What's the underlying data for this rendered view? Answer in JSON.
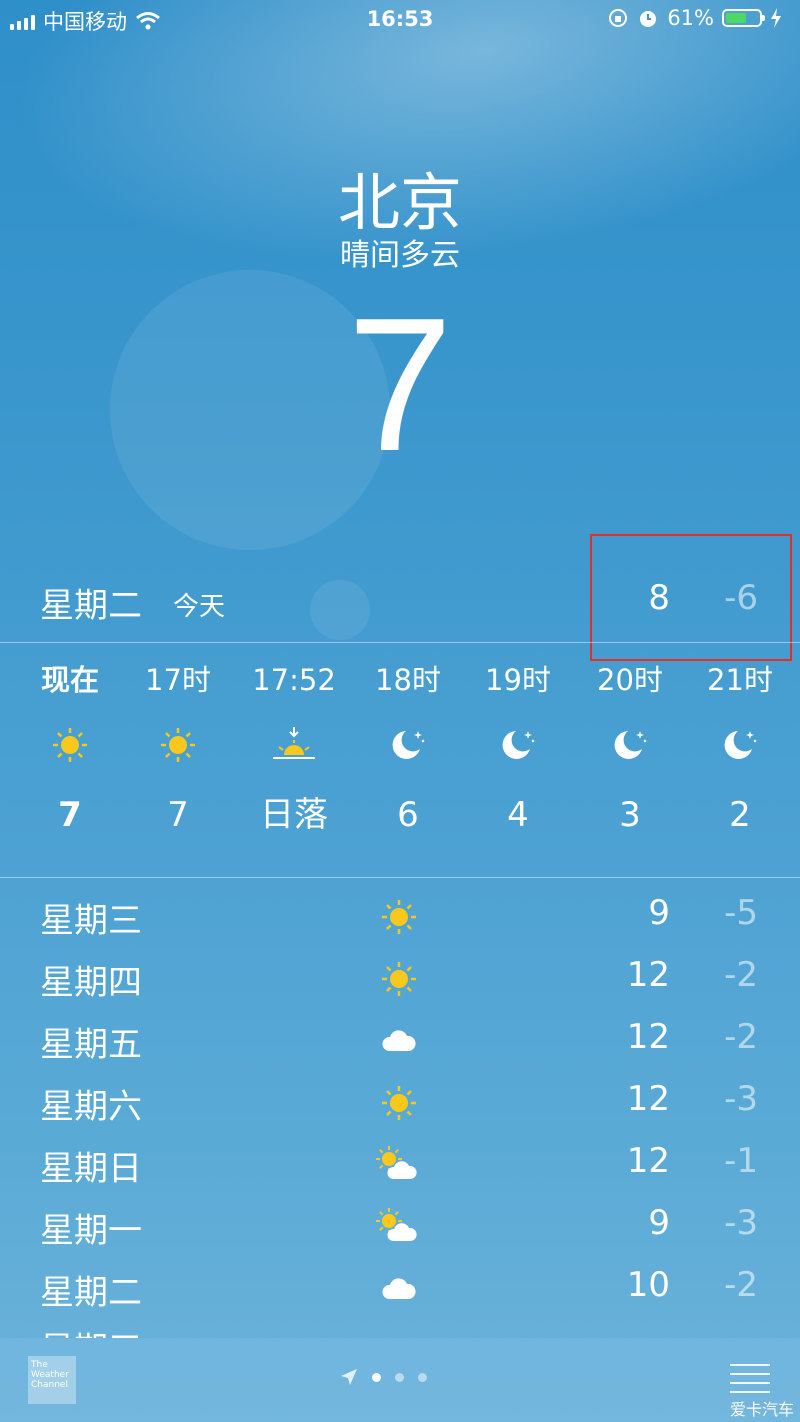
{
  "status_bar": {
    "carrier": "中国移动",
    "time": "16:53",
    "battery_percent": "61%",
    "battery_level": 0.61
  },
  "location": {
    "city": "北京",
    "condition": "晴间多云",
    "current_temp": "7"
  },
  "today": {
    "day": "星期二",
    "tag": "今天",
    "high": "8",
    "low": "-6"
  },
  "hourly": [
    {
      "label": "现在",
      "icon": "sun-icon",
      "temp": "7",
      "bold": true
    },
    {
      "label": "17时",
      "icon": "sun-icon",
      "temp": "7"
    },
    {
      "label": "17:52",
      "icon": "sunset-icon",
      "temp": "日落"
    },
    {
      "label": "18时",
      "icon": "moon-icon",
      "temp": "6"
    },
    {
      "label": "19时",
      "icon": "moon-icon",
      "temp": "4"
    },
    {
      "label": "20时",
      "icon": "moon-icon",
      "temp": "3"
    },
    {
      "label": "21时",
      "icon": "moon-icon",
      "temp": "2"
    }
  ],
  "daily": [
    {
      "day": "星期三",
      "icon": "sun-icon",
      "high": "9",
      "low": "-5"
    },
    {
      "day": "星期四",
      "icon": "sun-icon",
      "high": "12",
      "low": "-2"
    },
    {
      "day": "星期五",
      "icon": "cloud-icon",
      "high": "12",
      "low": "-2"
    },
    {
      "day": "星期六",
      "icon": "sun-icon",
      "high": "12",
      "low": "-3"
    },
    {
      "day": "星期日",
      "icon": "partly-cloudy-icon",
      "high": "12",
      "low": "-1"
    },
    {
      "day": "星期一",
      "icon": "partly-cloudy-icon",
      "high": "9",
      "low": "-3"
    },
    {
      "day": "星期二",
      "icon": "cloud-icon",
      "high": "10",
      "low": "-2"
    }
  ],
  "partial_day": "星期三",
  "bottom_bar": {
    "brand": "The Weather Channel",
    "page_count": 4,
    "active_page": 1
  },
  "watermark": "爱卡汽车",
  "colors": {
    "sun": "#f8c81c",
    "highlight": "#e0302a",
    "battery": "#4cd964"
  }
}
